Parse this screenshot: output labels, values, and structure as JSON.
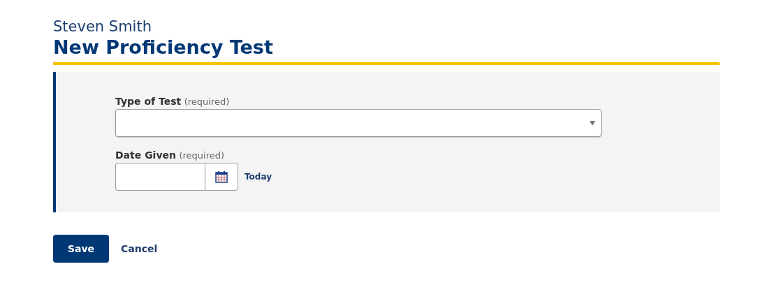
{
  "header": {
    "subtitle": "Steven Smith",
    "title": "New Proficiency Test"
  },
  "fields": [
    {
      "kind": "select",
      "label": "Type of Test",
      "hint": "(required)"
    },
    {
      "kind": "date",
      "label": "Date Given",
      "hint": "(required)",
      "link": "Today"
    }
  ],
  "buttons": [
    {
      "kind": "primary",
      "label": "Save"
    },
    {
      "kind": "link",
      "label": "Cancel"
    }
  ]
}
